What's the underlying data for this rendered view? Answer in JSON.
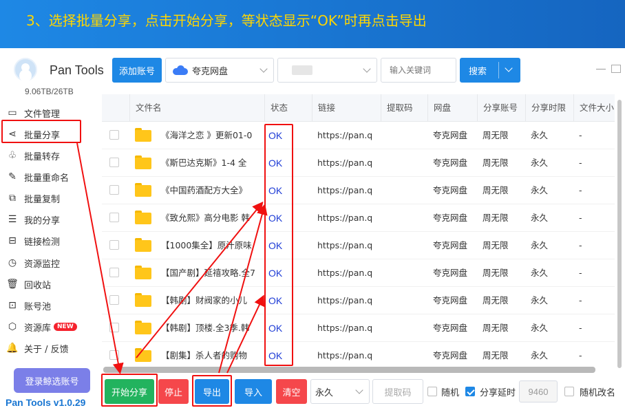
{
  "banner": {
    "text": "3、选择批量分享，点击开始分享，等状态显示“OK”时再点击导出"
  },
  "app": {
    "name": "Pan Tools",
    "storage": "9.06TB/26TB",
    "version": "Pan Tools v1.0.29"
  },
  "toolbar": {
    "add_account": "添加账号",
    "drive": "夸克网盘",
    "search_placeholder": "输入关键词",
    "search_label": "搜索"
  },
  "sidebar": {
    "items": [
      {
        "label": "文件管理",
        "icon": "folder-icon"
      },
      {
        "label": "批量分享",
        "icon": "share-icon"
      },
      {
        "label": "批量转存",
        "icon": "transfer-icon"
      },
      {
        "label": "批量重命名",
        "icon": "rename-icon"
      },
      {
        "label": "批量复制",
        "icon": "copy-icon"
      },
      {
        "label": "我的分享",
        "icon": "my-share-icon"
      },
      {
        "label": "链接检测",
        "icon": "link-check-icon"
      },
      {
        "label": "资源监控",
        "icon": "monitor-icon"
      },
      {
        "label": "回收站",
        "icon": "trash-icon"
      },
      {
        "label": "账号池",
        "icon": "account-pool-icon"
      },
      {
        "label": "资源库",
        "icon": "resource-icon",
        "badge": "NEW"
      },
      {
        "label": "关于 / 反馈",
        "icon": "bell-icon"
      }
    ],
    "login_button": "登录鲸选账号"
  },
  "table": {
    "columns": [
      "文件名",
      "状态",
      "链接",
      "提取码",
      "网盘",
      "分享账号",
      "分享时限",
      "文件大小"
    ],
    "rows": [
      {
        "name": "《海洋之恋 》更新01-0",
        "status": "OK",
        "link": "https://pan.q",
        "code": "",
        "drive": "夸克网盘",
        "account": "周无限",
        "limit": "永久",
        "size": "-"
      },
      {
        "name": "《斯巴达克斯》1-4 全",
        "status": "OK",
        "link": "https://pan.q",
        "code": "",
        "drive": "夸克网盘",
        "account": "周无限",
        "limit": "永久",
        "size": "-"
      },
      {
        "name": "《中国药酒配方大全》",
        "status": "OK",
        "link": "https://pan.q",
        "code": "",
        "drive": "夸克网盘",
        "account": "周无限",
        "limit": "永久",
        "size": "-"
      },
      {
        "name": "《致允熙》高分电影 韩",
        "status": "OK",
        "link": "https://pan.q",
        "code": "",
        "drive": "夸克网盘",
        "account": "周无限",
        "limit": "永久",
        "size": "-"
      },
      {
        "name": "【1000集全】原汁原味",
        "status": "OK",
        "link": "https://pan.q",
        "code": "",
        "drive": "夸克网盘",
        "account": "周无限",
        "limit": "永久",
        "size": "-"
      },
      {
        "name": "【国产剧】延禧攻略.全7",
        "status": "OK",
        "link": "https://pan.q",
        "code": "",
        "drive": "夸克网盘",
        "account": "周无限",
        "limit": "永久",
        "size": "-"
      },
      {
        "name": "【韩剧】财阀家的小儿",
        "status": "OK",
        "link": "https://pan.q",
        "code": "",
        "drive": "夸克网盘",
        "account": "周无限",
        "limit": "永久",
        "size": "-"
      },
      {
        "name": "【韩剧】顶楼.全3季.韩",
        "status": "OK",
        "link": "https://pan.q",
        "code": "",
        "drive": "夸克网盘",
        "account": "周无限",
        "limit": "永久",
        "size": "-"
      },
      {
        "name": "【剧集】杀人者的购物",
        "status": "OK",
        "link": "https://pan.q",
        "code": "",
        "drive": "夸克网盘",
        "account": "周无限",
        "limit": "永久",
        "size": "-"
      }
    ]
  },
  "bottom": {
    "start": "开始分享",
    "stop": "停止",
    "export": "导出",
    "import": "导入",
    "clear": "清空",
    "duration": "永久",
    "code_placeholder": "提取码",
    "random_label": "随机",
    "random_checked": false,
    "delay_label": "分享延时",
    "delay_checked": true,
    "delay_value": "9460",
    "rename_label": "随机改名",
    "rename_checked": false
  },
  "colors": {
    "accent": "#1e88e5",
    "success": "#22b35e",
    "danger": "#f5474b",
    "annotation": "#f01010",
    "banner_text": "#ffd600",
    "status_ok": "#1e3cd6"
  }
}
